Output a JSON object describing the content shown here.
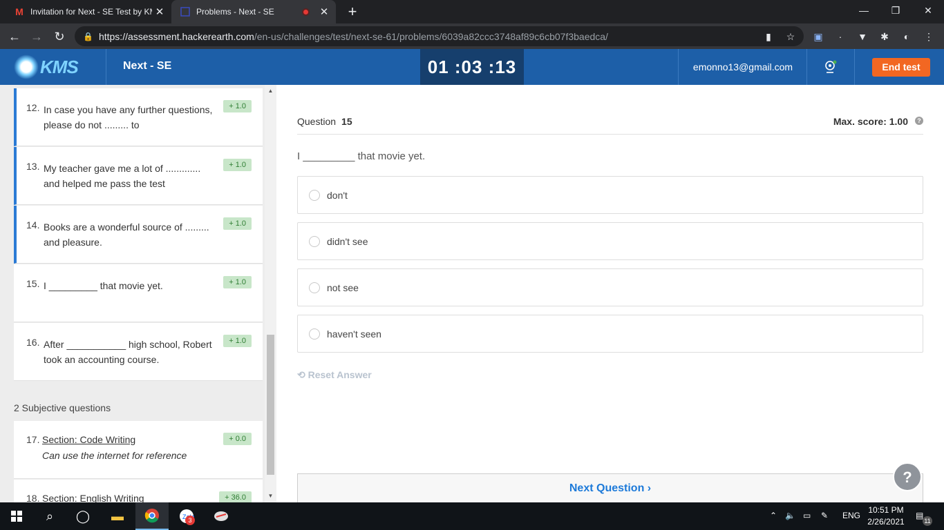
{
  "browser": {
    "tabs": [
      {
        "title": "Invitation for Next - SE Test by KMS",
        "icon": "gmail-icon"
      },
      {
        "title": "Problems - Next - SE",
        "icon": "hackerearth-icon",
        "recording": true
      }
    ],
    "url_host": "https://assessment.hackerearth.com",
    "url_path": "/en-us/challenges/test/next-se-61/problems/6039a82ccc3748af89c6cb07f3baedca/"
  },
  "header": {
    "logo_text": "KMS",
    "test_name": "Next - SE",
    "timer": "01 :03 :13",
    "email": "emonno13@gmail.com",
    "end_test_label": "End test"
  },
  "sidebar": {
    "questions": [
      {
        "num": "12.",
        "text": "In case you have any further questions, please do not ......... to",
        "score": "+ 1.0",
        "answered": true
      },
      {
        "num": "13.",
        "text": "My teacher gave me a lot of ............. and helped me pass the test",
        "score": "+ 1.0",
        "answered": true
      },
      {
        "num": "14.",
        "text": "Books are a wonderful source of ......... and pleasure.",
        "score": "+ 1.0",
        "answered": true
      },
      {
        "num": "15.",
        "text": "I _________ that movie yet.",
        "score": "+ 1.0",
        "answered": false
      },
      {
        "num": "16.",
        "text": "After ___________ high school, Robert took an accounting course.",
        "score": "+ 1.0",
        "answered": false
      }
    ],
    "subjective_header": "2 Subjective questions",
    "subjective": [
      {
        "num": "17.",
        "title": "Section: Code Writing",
        "desc": "Can use the internet for reference",
        "score": "+ 0.0"
      },
      {
        "num": "18.",
        "title": "Section: English Writing",
        "desc": "",
        "score": "+ 36.0"
      }
    ]
  },
  "main": {
    "question_label": "Question",
    "question_number": "15",
    "max_score": "Max. score: 1.00",
    "statement": "I _________ that movie yet.",
    "options": [
      "don't",
      "didn't see",
      "not see",
      "haven't seen"
    ],
    "reset_label": "Reset Answer",
    "next_label": "Next Question ›",
    "help_label": "?"
  },
  "taskbar": {
    "language": "ENG",
    "time": "10:51 PM",
    "date": "2/26/2021",
    "zalo_badge": "3",
    "notif_badge": "11"
  }
}
